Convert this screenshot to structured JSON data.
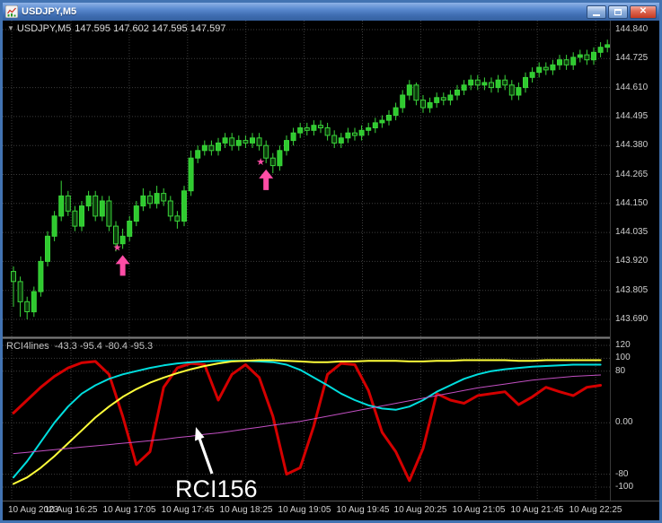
{
  "window": {
    "title": "USDJPY,M5",
    "close_glyph": "✕"
  },
  "icons": {
    "star": "★",
    "collapse_triangle": "▼"
  },
  "chart": {
    "info": {
      "collapse_glyph": "▼",
      "symbol": "USDJPY,M5",
      "ohlc": "147.595 147.602 147.595 147.597"
    },
    "price_axis_labels": [
      "144.840",
      "144.725",
      "144.610",
      "144.495",
      "144.380",
      "144.265",
      "144.150",
      "144.035",
      "143.920",
      "143.805",
      "143.690"
    ],
    "time_axis_labels": [
      "10 Aug 2023",
      "10 Aug 16:25",
      "10 Aug 17:05",
      "10 Aug 17:45",
      "10 Aug 18:25",
      "10 Aug 19:05",
      "10 Aug 19:45",
      "10 Aug 20:25",
      "10 Aug 21:05",
      "10 Aug 21:45",
      "10 Aug 22:25"
    ]
  },
  "indicator_panel": {
    "label": "RCI4lines",
    "values": "-43.3 -95.4 -80.4 -95.3",
    "scale_labels": [
      "120",
      "100",
      "80",
      "0.00",
      "-80",
      "-100"
    ]
  },
  "annotation": {
    "text": "RCI156"
  },
  "colors": {
    "titlebar_blue": "#4a7cc0",
    "close_red": "#c43a22",
    "chart_bg": "#000000",
    "grid": "#3d3d3d",
    "candle_stroke": "#3ad43a",
    "candle_bull_fill": "#2fca2f",
    "candle_bear_fill": "#0b3a0b",
    "signal_pink": "#ff4da6",
    "axis_text": "#cfcfcf",
    "annotation_white": "#ffffff"
  },
  "chart_data": {
    "type": "candlestick",
    "symbol": "USDJPY",
    "timeframe": "M5",
    "price_range": [
      143.69,
      144.84
    ],
    "price_gridlines": [
      144.84,
      144.725,
      144.61,
      144.495,
      144.38,
      144.265,
      144.15,
      144.035,
      143.92,
      143.805,
      143.69
    ],
    "info_ohlc_values": [
      147.595,
      147.602,
      147.595,
      147.597
    ],
    "candles_ohlc": [
      [
        143.88,
        143.9,
        143.74,
        143.84
      ],
      [
        143.84,
        143.86,
        143.7,
        143.76
      ],
      [
        143.76,
        143.78,
        143.69,
        143.72
      ],
      [
        143.72,
        143.82,
        143.7,
        143.8
      ],
      [
        143.8,
        143.94,
        143.78,
        143.92
      ],
      [
        143.92,
        144.04,
        143.9,
        144.02
      ],
      [
        144.02,
        144.12,
        144.0,
        144.1
      ],
      [
        144.1,
        144.24,
        144.08,
        144.18
      ],
      [
        144.18,
        144.2,
        144.1,
        144.12
      ],
      [
        144.12,
        144.14,
        144.04,
        144.06
      ],
      [
        144.06,
        144.16,
        144.04,
        144.14
      ],
      [
        144.14,
        144.2,
        144.12,
        144.18
      ],
      [
        144.18,
        144.2,
        144.08,
        144.1
      ],
      [
        144.1,
        144.18,
        144.08,
        144.16
      ],
      [
        144.16,
        144.18,
        144.04,
        144.06
      ],
      [
        144.06,
        144.08,
        143.96,
        143.99
      ],
      [
        143.99,
        144.05,
        143.97,
        144.02
      ],
      [
        144.02,
        144.1,
        144.0,
        144.08
      ],
      [
        144.08,
        144.16,
        144.06,
        144.14
      ],
      [
        144.14,
        144.21,
        144.12,
        144.18
      ],
      [
        144.18,
        144.2,
        144.13,
        144.15
      ],
      [
        144.15,
        144.22,
        144.13,
        144.19
      ],
      [
        144.19,
        144.21,
        144.14,
        144.16
      ],
      [
        144.16,
        144.18,
        144.08,
        144.1
      ],
      [
        144.1,
        144.12,
        144.05,
        144.08
      ],
      [
        144.08,
        144.22,
        144.06,
        144.2
      ],
      [
        144.2,
        144.36,
        144.18,
        144.33
      ],
      [
        144.33,
        144.38,
        144.31,
        144.36
      ],
      [
        144.36,
        144.4,
        144.34,
        144.38
      ],
      [
        144.38,
        144.4,
        144.34,
        144.36
      ],
      [
        144.36,
        144.41,
        144.34,
        144.39
      ],
      [
        144.39,
        144.43,
        144.37,
        144.41
      ],
      [
        144.41,
        144.43,
        144.36,
        144.38
      ],
      [
        144.38,
        144.42,
        144.36,
        144.4
      ],
      [
        144.4,
        144.42,
        144.37,
        144.39
      ],
      [
        144.39,
        144.43,
        144.37,
        144.41
      ],
      [
        144.41,
        144.43,
        144.36,
        144.38
      ],
      [
        144.38,
        144.4,
        144.31,
        144.33
      ],
      [
        144.33,
        144.35,
        144.27,
        144.3
      ],
      [
        144.3,
        144.38,
        144.28,
        144.36
      ],
      [
        144.36,
        144.42,
        144.34,
        144.4
      ],
      [
        144.4,
        144.45,
        144.38,
        144.43
      ],
      [
        144.43,
        144.47,
        144.41,
        144.45
      ],
      [
        144.45,
        144.47,
        144.42,
        144.44
      ],
      [
        144.44,
        144.48,
        144.42,
        144.46
      ],
      [
        144.46,
        144.48,
        144.43,
        144.45
      ],
      [
        144.45,
        144.47,
        144.4,
        144.42
      ],
      [
        144.42,
        144.44,
        144.37,
        144.39
      ],
      [
        144.39,
        144.43,
        144.37,
        144.41
      ],
      [
        144.41,
        144.45,
        144.39,
        144.43
      ],
      [
        144.43,
        144.45,
        144.4,
        144.42
      ],
      [
        144.42,
        144.46,
        144.4,
        144.44
      ],
      [
        144.44,
        144.47,
        144.42,
        144.45
      ],
      [
        144.45,
        144.49,
        144.43,
        144.47
      ],
      [
        144.47,
        144.5,
        144.45,
        144.48
      ],
      [
        144.48,
        144.52,
        144.46,
        144.5
      ],
      [
        144.5,
        144.55,
        144.48,
        144.53
      ],
      [
        144.53,
        144.6,
        144.51,
        144.58
      ],
      [
        144.58,
        144.64,
        144.56,
        144.62
      ],
      [
        144.62,
        144.63,
        144.54,
        144.56
      ],
      [
        144.56,
        144.58,
        144.51,
        144.53
      ],
      [
        144.53,
        144.57,
        144.51,
        144.55
      ],
      [
        144.55,
        144.59,
        144.53,
        144.57
      ],
      [
        144.57,
        144.59,
        144.54,
        144.56
      ],
      [
        144.56,
        144.6,
        144.54,
        144.58
      ],
      [
        144.58,
        144.62,
        144.56,
        144.6
      ],
      [
        144.6,
        144.64,
        144.58,
        144.62
      ],
      [
        144.62,
        144.66,
        144.6,
        144.64
      ],
      [
        144.64,
        144.66,
        144.6,
        144.62
      ],
      [
        144.62,
        144.65,
        144.6,
        144.63
      ],
      [
        144.63,
        144.65,
        144.59,
        144.61
      ],
      [
        144.61,
        144.66,
        144.59,
        144.64
      ],
      [
        144.64,
        144.66,
        144.6,
        144.62
      ],
      [
        144.62,
        144.64,
        144.56,
        144.58
      ],
      [
        144.58,
        144.63,
        144.56,
        144.61
      ],
      [
        144.61,
        144.67,
        144.59,
        144.65
      ],
      [
        144.65,
        144.69,
        144.63,
        144.67
      ],
      [
        144.67,
        144.71,
        144.65,
        144.69
      ],
      [
        144.69,
        144.71,
        144.66,
        144.68
      ],
      [
        144.68,
        144.72,
        144.66,
        144.7
      ],
      [
        144.7,
        144.74,
        144.68,
        144.72
      ],
      [
        144.72,
        144.74,
        144.68,
        144.7
      ],
      [
        144.7,
        144.75,
        144.68,
        144.73
      ],
      [
        144.73,
        144.76,
        144.71,
        144.74
      ],
      [
        144.74,
        144.76,
        144.7,
        144.72
      ],
      [
        144.72,
        144.77,
        144.7,
        144.75
      ],
      [
        144.75,
        144.79,
        144.73,
        144.77
      ],
      [
        144.77,
        144.8,
        144.75,
        144.78
      ]
    ],
    "buy_markers": [
      {
        "bar": 16,
        "price": 143.945
      },
      {
        "bar": 37,
        "price": 144.285
      }
    ],
    "indicator": {
      "name": "RCI4lines",
      "current_values": [
        -43.3,
        -95.4,
        -80.4,
        -95.3
      ],
      "levels": [
        120,
        100,
        80,
        0,
        -80,
        -100
      ],
      "range": [
        -110,
        125
      ],
      "sample_step_bars": 2,
      "series": [
        {
          "name": "rci-short-red",
          "color": "#d40000",
          "width": 3,
          "values": [
            15,
            35,
            55,
            72,
            85,
            93,
            95,
            75,
            10,
            -65,
            -45,
            55,
            85,
            92,
            90,
            35,
            75,
            90,
            70,
            10,
            -80,
            -70,
            -5,
            75,
            92,
            90,
            50,
            -15,
            -45,
            -90,
            -40,
            45,
            35,
            30,
            42,
            45,
            48,
            28,
            40,
            55,
            48,
            42,
            55,
            58
          ]
        },
        {
          "name": "rci-mid-cyan",
          "color": "#00dede",
          "width": 2,
          "values": [
            -85,
            -60,
            -30,
            0,
            25,
            45,
            58,
            68,
            75,
            80,
            85,
            89,
            92,
            94,
            95,
            96,
            96,
            96,
            95,
            94,
            90,
            82,
            70,
            58,
            45,
            35,
            27,
            22,
            20,
            25,
            35,
            48,
            58,
            68,
            75,
            80,
            83,
            85,
            87,
            88,
            89,
            90,
            90,
            90
          ]
        },
        {
          "name": "rci-long-yellow",
          "color": "#ffff3a",
          "width": 2,
          "values": [
            -95,
            -85,
            -70,
            -52,
            -32,
            -12,
            8,
            25,
            40,
            52,
            62,
            70,
            77,
            83,
            88,
            92,
            95,
            96,
            97,
            97,
            96,
            95,
            94,
            94,
            95,
            95,
            96,
            96,
            96,
            95,
            95,
            96,
            96,
            97,
            97,
            97,
            97,
            96,
            96,
            97,
            97,
            97,
            97,
            97
          ]
        },
        {
          "name": "RCI156-magenta",
          "color": "#c24fc2",
          "width": 1,
          "values": [
            -48,
            -46,
            -44,
            -42,
            -40,
            -38,
            -36,
            -34,
            -32,
            -30,
            -28,
            -26,
            -23,
            -21,
            -18,
            -16,
            -13,
            -10,
            -7,
            -4,
            -1,
            2,
            6,
            10,
            14,
            18,
            22,
            26,
            30,
            34,
            38,
            42,
            46,
            50,
            54,
            57,
            60,
            63,
            66,
            68,
            70,
            72,
            73,
            74
          ]
        }
      ]
    }
  }
}
